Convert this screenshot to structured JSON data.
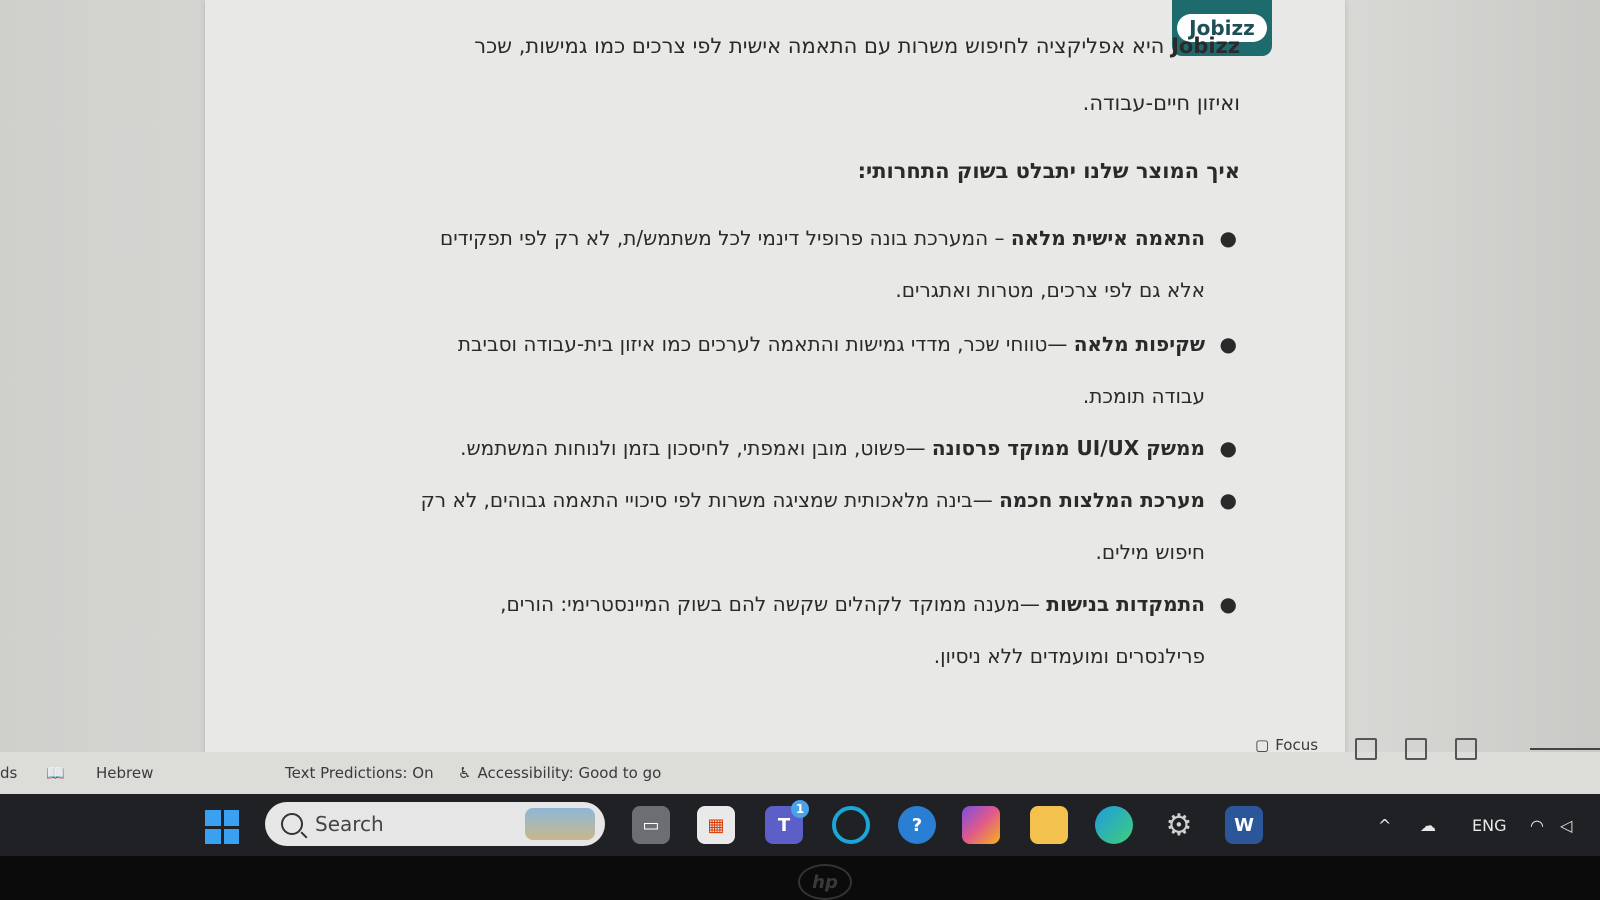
{
  "document": {
    "logo_text": "Jobizz",
    "intro_brand": "Jobizz",
    "intro_rest": "היא אפליקציה לחיפוש משרות עם התאמה אישית לפי צרכים כמו גמישות, שכר",
    "intro_line2": "ואיזון חיים-עבודה.",
    "heading": "איך המוצר שלנו יתבלט בשוק התחרותי:",
    "bullets": [
      {
        "term": "התאמה אישית מלאה",
        "text": " – המערכת בונה פרופיל דינמי לכל משתמש/ת, לא רק לפי תפקידים אלא גם לפי צרכים, מטרות ואתגרים."
      },
      {
        "term": "שקיפות מלאה",
        "text": " —טווחי שכר, מדדי גמישות והתאמה לערכים כמו איזון בית-עבודה וסביבת עבודה תומכת."
      },
      {
        "term": "ממשק UI/UX ממוקד פרסונה",
        "text": " —פשוט, מובן ואמפתי, לחיסכון בזמן ולנוחות המשתמש."
      },
      {
        "term": "מערכת המלצות חכמה",
        "text": " —בינה מלאכותית שמציגה משרות לפי סיכויי התאמה גבוהים, לא רק חיפוש מילים."
      },
      {
        "term": "התמקדות בנישות",
        "text": " —מענה ממוקד לקהלים שקשה להם בשוק המיינסטרימי: הורים, פרילנסרים ומועמדים ללא ניסיון."
      }
    ]
  },
  "statusbar": {
    "words_fragment": "ds",
    "language": "Hebrew",
    "text_predictions": "Text Predictions: On",
    "accessibility": "Accessibility: Good to go",
    "focus": "Focus"
  },
  "taskbar": {
    "search_placeholder": "Search",
    "teams_badge": "1",
    "tray_language": "ENG"
  },
  "bezel": {
    "brand": "hp"
  },
  "colors": {
    "logo_bg": "#1e6b6e",
    "taskbar_bg": "#1f2124",
    "windows_blue": "#3aa0f0"
  }
}
